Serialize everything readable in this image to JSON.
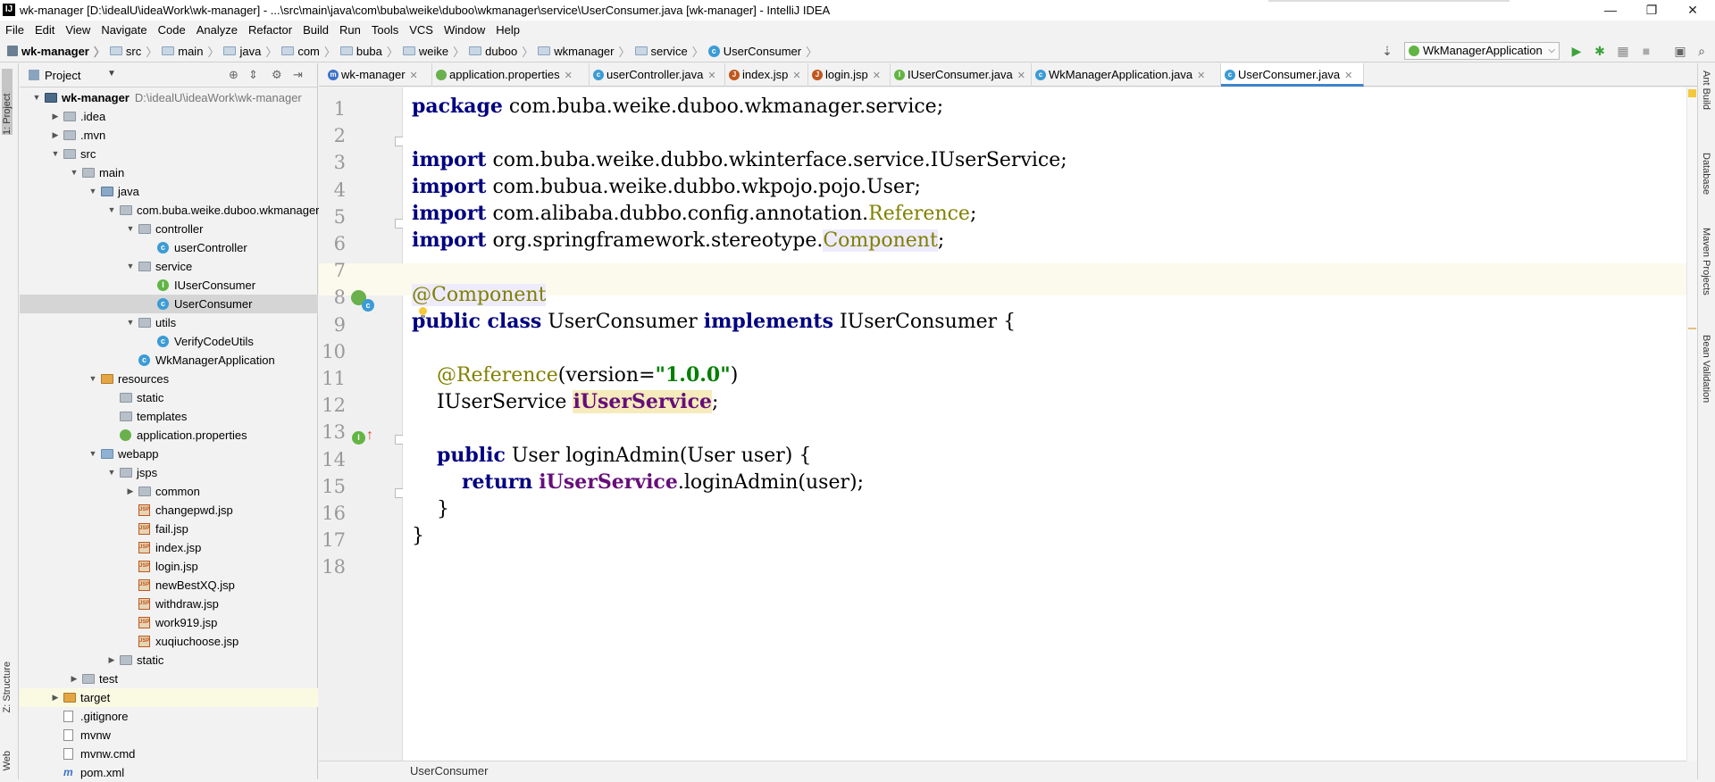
{
  "window": {
    "title": "wk-manager [D:\\idealU\\ideaWork\\wk-manager] - ...\\src\\main\\java\\com\\buba\\weike\\duboo\\wkmanager\\service\\UserConsumer.java [wk-manager] - IntelliJ IDEA",
    "minimize": "—",
    "maximize": "❐",
    "close": "✕"
  },
  "menu": [
    "File",
    "Edit",
    "View",
    "Navigate",
    "Code",
    "Analyze",
    "Refactor",
    "Build",
    "Run",
    "Tools",
    "VCS",
    "Window",
    "Help"
  ],
  "breadcrumbs": [
    "wk-manager",
    "src",
    "main",
    "java",
    "com",
    "buba",
    "weike",
    "duboo",
    "wkmanager",
    "service",
    "UserConsumer"
  ],
  "toolbar": {
    "run_config": "WkManagerApplication"
  },
  "left_tabs": [
    "1: Project",
    "Z: Structure",
    "Web"
  ],
  "right_tabs": [
    "Ant Build",
    "Database",
    "Maven Projects",
    "Bean Validation"
  ],
  "project_panel": {
    "title": "Project",
    "tree": [
      {
        "label": "wk-manager",
        "path": "D:\\idealU\\ideaWork\\wk-manager",
        "depth": 0,
        "icon": "module",
        "expanded": true,
        "bold": true
      },
      {
        "label": ".idea",
        "depth": 1,
        "icon": "folder-gray",
        "expanded": false
      },
      {
        "label": ".mvn",
        "depth": 1,
        "icon": "folder-gray",
        "expanded": false
      },
      {
        "label": "src",
        "depth": 1,
        "icon": "folder-gray",
        "expanded": true
      },
      {
        "label": "main",
        "depth": 2,
        "icon": "folder-gray",
        "expanded": true
      },
      {
        "label": "java",
        "depth": 3,
        "icon": "folder-src",
        "expanded": true
      },
      {
        "label": "com.buba.weike.duboo.wkmanager",
        "depth": 4,
        "icon": "folder-gray",
        "expanded": true
      },
      {
        "label": "controller",
        "depth": 5,
        "icon": "folder-gray",
        "expanded": true
      },
      {
        "label": "userController",
        "depth": 6,
        "icon": "class",
        "leaf": true
      },
      {
        "label": "service",
        "depth": 5,
        "icon": "folder-gray",
        "expanded": true
      },
      {
        "label": "IUserConsumer",
        "depth": 6,
        "icon": "interface",
        "leaf": true
      },
      {
        "label": "UserConsumer",
        "depth": 6,
        "icon": "class",
        "leaf": true,
        "selected": true
      },
      {
        "label": "utils",
        "depth": 5,
        "icon": "folder-gray",
        "expanded": true
      },
      {
        "label": "VerifyCodeUtils",
        "depth": 6,
        "icon": "class",
        "leaf": true
      },
      {
        "label": "WkManagerApplication",
        "depth": 5,
        "icon": "spring-class",
        "leaf": true
      },
      {
        "label": "resources",
        "depth": 3,
        "icon": "folder-orange",
        "expanded": true
      },
      {
        "label": "static",
        "depth": 4,
        "icon": "folder-gray",
        "leaf": true
      },
      {
        "label": "templates",
        "depth": 4,
        "icon": "folder-gray",
        "leaf": true
      },
      {
        "label": "application.properties",
        "depth": 4,
        "icon": "spring",
        "leaf": true
      },
      {
        "label": "webapp",
        "depth": 3,
        "icon": "folder-blue",
        "expanded": true
      },
      {
        "label": "jsps",
        "depth": 4,
        "icon": "folder-gray",
        "expanded": true
      },
      {
        "label": "common",
        "depth": 5,
        "icon": "folder-gray",
        "expanded": false
      },
      {
        "label": "changepwd.jsp",
        "depth": 5,
        "icon": "jsp",
        "leaf": true
      },
      {
        "label": "fail.jsp",
        "depth": 5,
        "icon": "jsp",
        "leaf": true
      },
      {
        "label": "index.jsp",
        "depth": 5,
        "icon": "jsp",
        "leaf": true
      },
      {
        "label": "login.jsp",
        "depth": 5,
        "icon": "jsp",
        "leaf": true
      },
      {
        "label": "newBestXQ.jsp",
        "depth": 5,
        "icon": "jsp",
        "leaf": true
      },
      {
        "label": "withdraw.jsp",
        "depth": 5,
        "icon": "jsp",
        "leaf": true
      },
      {
        "label": "work919.jsp",
        "depth": 5,
        "icon": "jsp",
        "leaf": true
      },
      {
        "label": "xuqiuchoose.jsp",
        "depth": 5,
        "icon": "jsp",
        "leaf": true
      },
      {
        "label": "static",
        "depth": 4,
        "icon": "folder-gray",
        "expanded": false
      },
      {
        "label": "test",
        "depth": 2,
        "icon": "folder-gray",
        "expanded": false
      },
      {
        "label": "target",
        "depth": 1,
        "icon": "folder-orange",
        "expanded": false,
        "highlight": true
      },
      {
        "label": ".gitignore",
        "depth": 1,
        "icon": "file",
        "leaf": true
      },
      {
        "label": "mvnw",
        "depth": 1,
        "icon": "file",
        "leaf": true
      },
      {
        "label": "mvnw.cmd",
        "depth": 1,
        "icon": "file",
        "leaf": true
      },
      {
        "label": "pom.xml",
        "depth": 1,
        "icon": "maven",
        "leaf": true
      }
    ]
  },
  "tabs": [
    {
      "label": "wk-manager",
      "icon": "maven",
      "color": "#3c72c8"
    },
    {
      "label": "application.properties",
      "icon": "spring",
      "color": "#6ab04c"
    },
    {
      "label": "userController.java",
      "icon": "class",
      "color": "#3c9bd6"
    },
    {
      "label": "index.jsp",
      "icon": "jsp",
      "color": "#c0571c"
    },
    {
      "label": "login.jsp",
      "icon": "jsp",
      "color": "#c0571c"
    },
    {
      "label": "IUserConsumer.java",
      "icon": "interface",
      "color": "#62b543"
    },
    {
      "label": "WkManagerApplication.java",
      "icon": "spring-class",
      "color": "#3c9bd6"
    },
    {
      "label": "UserConsumer.java",
      "icon": "class",
      "color": "#3c9bd6",
      "active": true
    }
  ],
  "editor": {
    "line_numbers": [
      "1",
      "2",
      "3",
      "4",
      "5",
      "6",
      "7",
      "8",
      "9",
      "10",
      "11",
      "12",
      "13",
      "14",
      "15",
      "16",
      "17",
      "18"
    ],
    "status_breadcrumb": "UserConsumer"
  },
  "colors": {
    "keyword": "#000080",
    "annotation": "#808000",
    "string": "#008000",
    "field": "#660e7a",
    "caret_row": "#fcfaed",
    "selection": "#d5d5d5",
    "accent": "#4083c9"
  }
}
